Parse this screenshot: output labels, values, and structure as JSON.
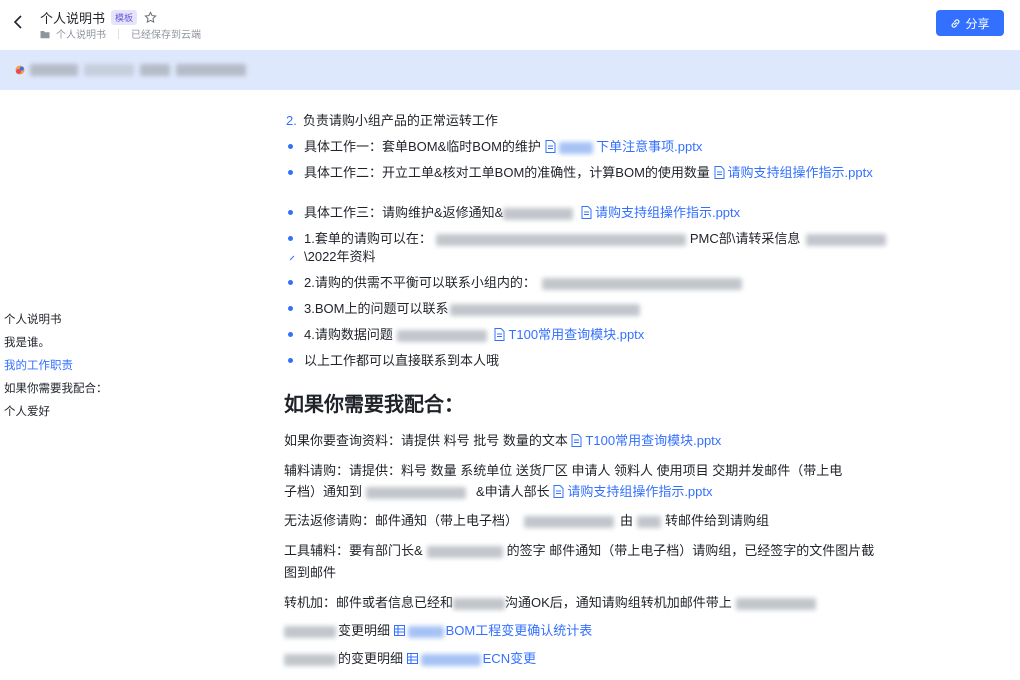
{
  "header": {
    "title": "个人说明书",
    "badge": "模板",
    "breadcrumb_folder": "个人说明书",
    "save_status": "已经保存到云端",
    "share_label": "分享"
  },
  "toc": {
    "items": [
      {
        "label": "个人说明书"
      },
      {
        "label": "我是谁。"
      },
      {
        "label": "我的工作职责"
      },
      {
        "label": "如果你需要我配合："
      },
      {
        "label": "个人爱好"
      }
    ]
  },
  "content": {
    "item2_num": "2.",
    "item2_text": "负责请购小组产品的正常运转工作",
    "task1_prefix": "具体工作一：套单BOM&临时BOM的维护",
    "task1_link": "下单注意事项.pptx",
    "task2_prefix": "具体工作二：开立工单&核对工单BOM的准确性，计算BOM的使用数量",
    "task2_link": "请购支持组操作指示.pptx",
    "task3_prefix": "具体工作三：请购维护&返修通知&",
    "task3_link": "请购支持组操作指示.pptx",
    "note1_prefix": "1.套单的请购可以在：",
    "note1_mid": "PMC部\\请转采信息",
    "note1_cont": "\\2022年资料",
    "note2_prefix": "2.请购的供需不平衡可以联系小组内的：",
    "note3_prefix": "3.BOM上的问题可以联系",
    "note4_prefix": "4.请购数据问题",
    "note4_link": "T100常用查询模块.pptx",
    "note5": "以上工作都可以直接联系到本人哦",
    "section_heading": "如果你需要我配合：",
    "p1_prefix": "如果你要查询资料：请提供  料号   批号   数量的文本",
    "p1_link": "T100常用查询模块.pptx",
    "p2_line1": "辅料请购：请提供：料号  数量  系统单位  送货厂区   申请人   领料人   使用项目   交期并发邮件（带上电",
    "p2_line2_prefix": "子档）通知到",
    "p2_line2_mid": "&申请人部长",
    "p2_link": "请购支持组操作指示.pptx",
    "p3_prefix": "无法返修请购：邮件通知（带上电子档）",
    "p3_mid": "由",
    "p3_suffix": "转邮件给到请购组",
    "p4_line1_prefix": "工具辅料：要有部门长&",
    "p4_line1_suffix": "的签字  邮件通知（带上电子档）请购组，已经签字的文件图片截",
    "p4_line2": "图到邮件",
    "p5_prefix": "转机加：邮件或者信息已经和",
    "p5_suffix": "沟通OK后，通知请购组转机加邮件带上",
    "p6_prefix": "变更明细",
    "p6_link": "BOM工程变更确认统计表",
    "p7_prefix": "的变更明细",
    "p7_link": "ECN变更"
  },
  "colors": {
    "accent": "#3370ff",
    "banner_bg": "#dde8fc",
    "badge_bg": "#e6e4fb"
  },
  "icons": [
    "chevron-left-icon",
    "star-icon",
    "folder-icon",
    "link-icon",
    "file-icon",
    "table-icon"
  ]
}
